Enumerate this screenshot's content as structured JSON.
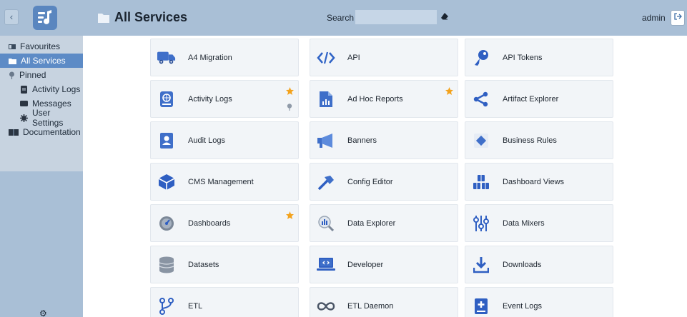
{
  "sidebar": {
    "items": [
      {
        "label": "Favourites",
        "icon": "favourites-icon",
        "active": false,
        "sub": false
      },
      {
        "label": "All Services",
        "icon": "folder-icon",
        "active": true,
        "sub": false
      },
      {
        "label": "Pinned",
        "icon": "pin-icon",
        "active": false,
        "sub": false
      },
      {
        "label": "Activity Logs",
        "icon": "activity-logs-icon",
        "active": false,
        "sub": true
      },
      {
        "label": "Messages",
        "icon": "messages-icon",
        "active": false,
        "sub": true
      },
      {
        "label": "User Settings",
        "icon": "gear-icon",
        "active": false,
        "sub": true
      },
      {
        "label": "Documentation",
        "icon": "book-icon",
        "active": false,
        "sub": false
      }
    ]
  },
  "header": {
    "title": "All Services",
    "search_label": "Search",
    "search_value": "",
    "user": "admin"
  },
  "services": [
    {
      "label": "A4 Migration",
      "icon": "truck-icon",
      "favourite": false,
      "pinned": false
    },
    {
      "label": "API",
      "icon": "code-icon",
      "favourite": false,
      "pinned": false
    },
    {
      "label": "API Tokens",
      "icon": "key-icon",
      "favourite": false,
      "pinned": false
    },
    {
      "label": "Activity Logs",
      "icon": "activity-logs-icon",
      "favourite": true,
      "pinned": true
    },
    {
      "label": "Ad Hoc Reports",
      "icon": "report-icon",
      "favourite": true,
      "pinned": false
    },
    {
      "label": "Artifact Explorer",
      "icon": "share-icon",
      "favourite": false,
      "pinned": false
    },
    {
      "label": "Audit Logs",
      "icon": "audit-icon",
      "favourite": false,
      "pinned": false
    },
    {
      "label": "Banners",
      "icon": "megaphone-icon",
      "favourite": false,
      "pinned": false
    },
    {
      "label": "Business Rules",
      "icon": "rules-icon",
      "favourite": false,
      "pinned": false
    },
    {
      "label": "CMS Management",
      "icon": "cube-icon",
      "favourite": false,
      "pinned": false
    },
    {
      "label": "Config Editor",
      "icon": "hammer-icon",
      "favourite": false,
      "pinned": false
    },
    {
      "label": "Dashboard Views",
      "icon": "cubes-icon",
      "favourite": false,
      "pinned": false
    },
    {
      "label": "Dashboards",
      "icon": "gauge-icon",
      "favourite": true,
      "pinned": false
    },
    {
      "label": "Data Explorer",
      "icon": "magnifier-chart-icon",
      "favourite": false,
      "pinned": false
    },
    {
      "label": "Data Mixers",
      "icon": "sliders-icon",
      "favourite": false,
      "pinned": false
    },
    {
      "label": "Datasets",
      "icon": "database-icon",
      "favourite": false,
      "pinned": false
    },
    {
      "label": "Developer",
      "icon": "laptop-code-icon",
      "favourite": false,
      "pinned": false
    },
    {
      "label": "Downloads",
      "icon": "download-icon",
      "favourite": false,
      "pinned": false
    },
    {
      "label": "ETL",
      "icon": "branch-icon",
      "favourite": false,
      "pinned": false
    },
    {
      "label": "ETL Daemon",
      "icon": "infinity-icon",
      "favourite": false,
      "pinned": false
    },
    {
      "label": "Event Logs",
      "icon": "event-log-icon",
      "favourite": false,
      "pinned": false
    }
  ],
  "colors": {
    "sidebar_bg": "#c7d3e0",
    "header_bg": "#a9bfd6",
    "active_item": "#5d8bc6",
    "accent_blue": "#3f6fc9",
    "star": "#f3a21c"
  }
}
